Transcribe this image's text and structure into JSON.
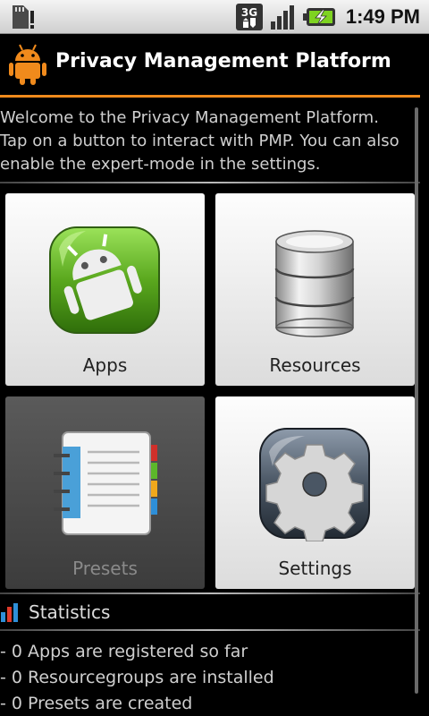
{
  "status_bar": {
    "network": "3G",
    "time": "1:49 PM"
  },
  "header": {
    "title": "Privacy Management Platform"
  },
  "welcome_text": [
    "Welcome to the Privacy Management Platform.",
    "Tap on a button to interact with PMP. You can also",
    "enable the expert-mode in the settings."
  ],
  "tiles": [
    {
      "label": "Apps",
      "enabled": true,
      "icon": "android-apps-icon"
    },
    {
      "label": "Resources",
      "enabled": true,
      "icon": "database-icon"
    },
    {
      "label": "Presets",
      "enabled": false,
      "icon": "notebook-icon"
    },
    {
      "label": "Settings",
      "enabled": true,
      "icon": "gear-icon"
    }
  ],
  "statistics": {
    "heading": "Statistics",
    "lines": [
      "- 0 Apps are registered so far",
      "- 0 Resourcegroups are installed",
      "- 0 Presets are created"
    ]
  },
  "colors": {
    "accent": "#f08a1c",
    "apps_green": "#5aa81e"
  }
}
